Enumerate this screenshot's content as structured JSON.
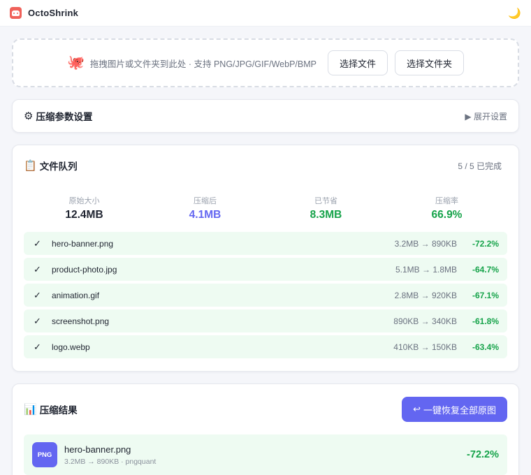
{
  "app": {
    "title": "OctoShrink",
    "theme_icon": "moon-icon"
  },
  "dropzone": {
    "icon": "octopus-icon",
    "text": "拖拽图片或文件夹到此处 · 支持 PNG/JPG/GIF/WebP/BMP",
    "select_files": "选择文件",
    "select_folder": "选择文件夹"
  },
  "settings": {
    "icon": "gear-icon",
    "title": "压缩参数设置",
    "expand": "▶ 展开设置"
  },
  "queue": {
    "icon": "clipboard-icon",
    "title": "文件队列",
    "count": "5 / 5 已完成",
    "stats": [
      {
        "label": "原始大小",
        "value": "12.4MB",
        "color": "#1f2430"
      },
      {
        "label": "压缩后",
        "value": "4.1MB",
        "color": "#6366f1"
      },
      {
        "label": "已节省",
        "value": "8.3MB",
        "color": "#16a34a"
      },
      {
        "label": "压缩率",
        "value": "66.9%",
        "color": "#16a34a"
      }
    ],
    "files": [
      {
        "check": "✓",
        "name": "hero-banner.png",
        "size": "3.2MB → 890KB",
        "pct": "-72.2%"
      },
      {
        "check": "✓",
        "name": "product-photo.jpg",
        "size": "5.1MB → 1.8MB",
        "pct": "-64.7%"
      },
      {
        "check": "✓",
        "name": "animation.gif",
        "size": "2.8MB → 920KB",
        "pct": "-67.1%"
      },
      {
        "check": "✓",
        "name": "screenshot.png",
        "size": "890KB → 340KB",
        "pct": "-61.8%"
      },
      {
        "check": "✓",
        "name": "logo.webp",
        "size": "410KB → 150KB",
        "pct": "-63.4%"
      }
    ]
  },
  "results": {
    "icon": "bar-chart-icon",
    "title": "压缩结果",
    "restore_icon": "undo-icon",
    "restore_label": "一键恢复全部原图",
    "items": [
      {
        "badge": "PNG",
        "name": "hero-banner.png",
        "meta": "3.2MB → 890KB · pngquant",
        "pct": "-72.2%"
      }
    ]
  },
  "colors": {
    "accent": "#6366f1",
    "success": "#16a34a",
    "row_bg": "#eefbf2"
  }
}
